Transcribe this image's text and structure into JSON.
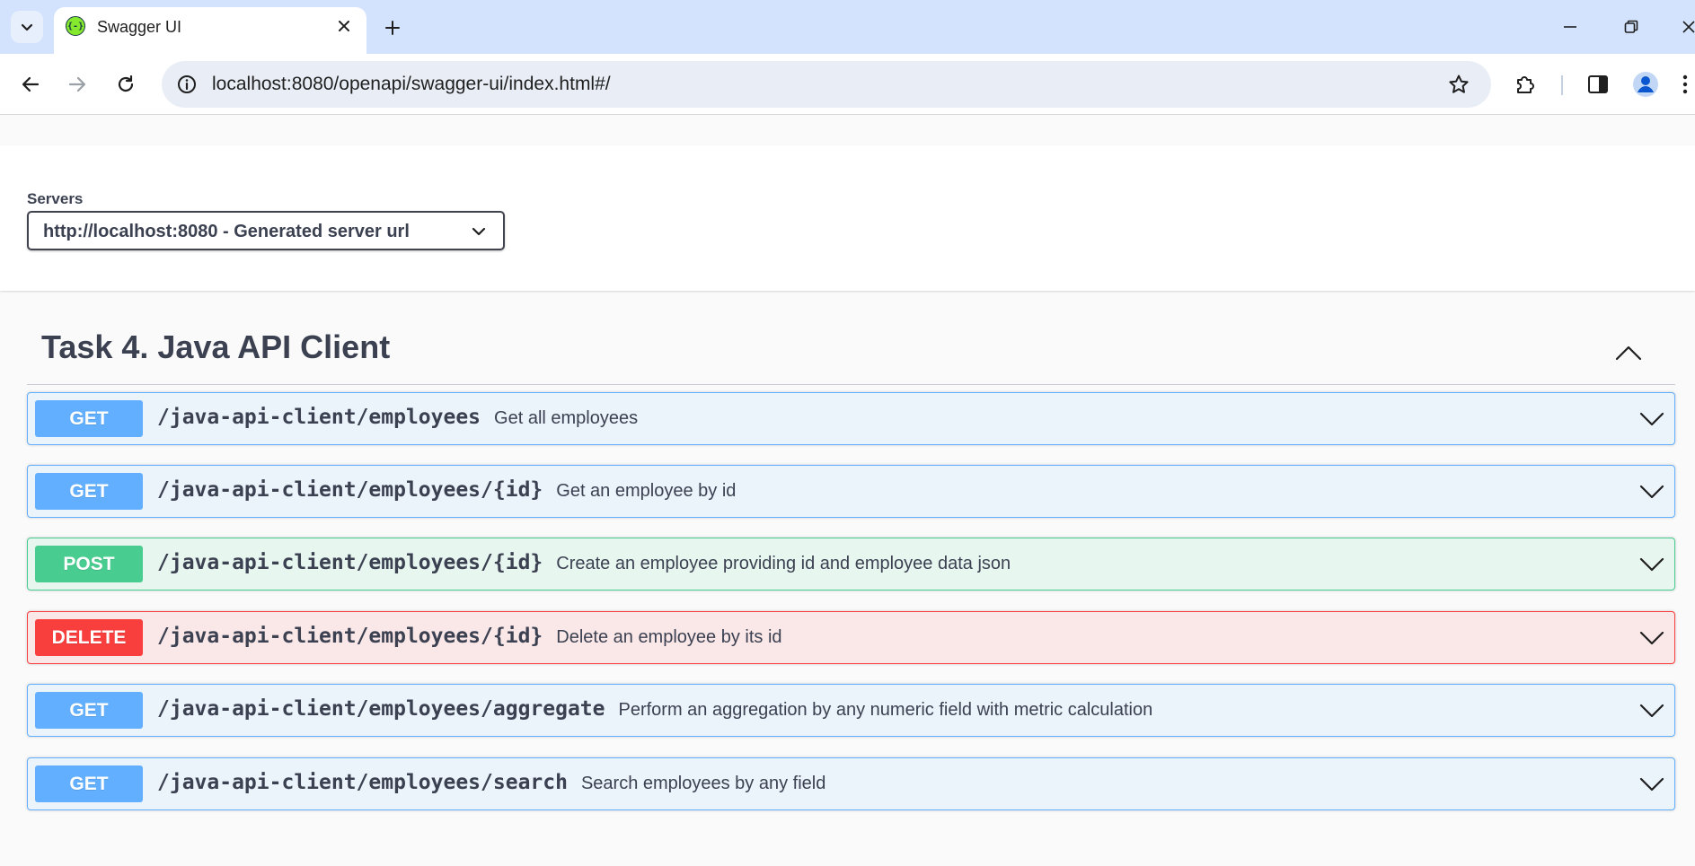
{
  "browser": {
    "tab_title": "Swagger UI",
    "favicon_text": "{-}",
    "url": "localhost:8080/openapi/swagger-ui/index.html#/"
  },
  "servers": {
    "label": "Servers",
    "selected": "http://localhost:8080 - Generated server url"
  },
  "tag": {
    "title": "Task 4. Java API Client"
  },
  "operations": [
    {
      "method": "GET",
      "path": "/java-api-client/employees",
      "summary": "Get all employees"
    },
    {
      "method": "GET",
      "path": "/java-api-client/employees/{id}",
      "summary": "Get an employee by id"
    },
    {
      "method": "POST",
      "path": "/java-api-client/employees/{id}",
      "summary": "Create an employee providing id and employee data json"
    },
    {
      "method": "DELETE",
      "path": "/java-api-client/employees/{id}",
      "summary": "Delete an employee by its id"
    },
    {
      "method": "GET",
      "path": "/java-api-client/employees/aggregate",
      "summary": "Perform an aggregation by any numeric field with metric calculation"
    },
    {
      "method": "GET",
      "path": "/java-api-client/employees/search",
      "summary": "Search employees by any field"
    }
  ],
  "colors": {
    "get": "#61affe",
    "post": "#49cc90",
    "delete": "#f93e3e",
    "tabbar": "#d3e3fd"
  }
}
